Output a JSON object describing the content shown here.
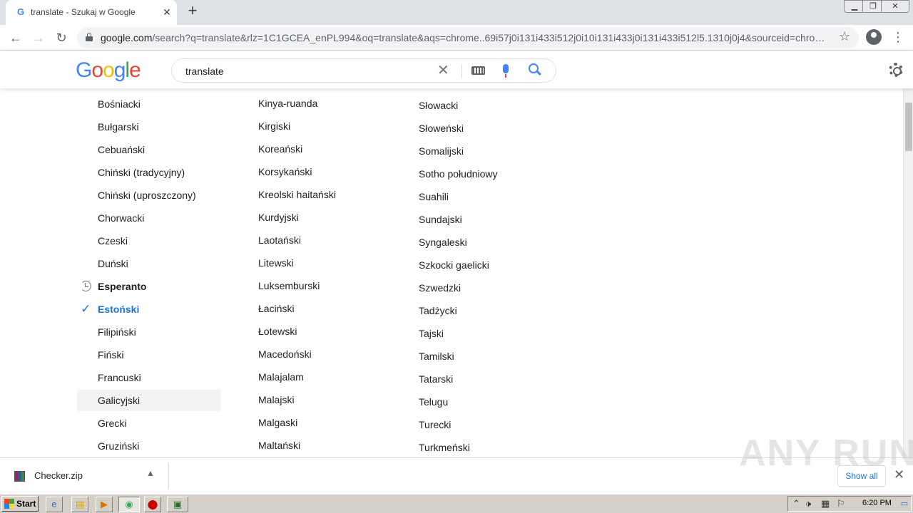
{
  "tab": {
    "favicon": "G",
    "title": "translate - Szukaj w Google"
  },
  "toolbar": {
    "url_host": "google.com",
    "url_path": "/search?q=translate&rlz=1C1GCEA_enPL994&oq=translate&aqs=chrome..69i57j0i131i433i512j0i10i131i433j0i131i433i512l5.1310j0j4&sourceid=chrom..."
  },
  "google": {
    "logo_letters": [
      "G",
      "o",
      "o",
      "g",
      "l",
      "e"
    ],
    "logo_colors": [
      "#4285f4",
      "#ea4335",
      "#fbbc05",
      "#4285f4",
      "#34a853",
      "#ea4335"
    ],
    "search_query": "translate"
  },
  "languages": {
    "col1": [
      "Bośniacki",
      "Bułgarski",
      "Cebuański",
      "Chiński (tradycyjny)",
      "Chiński (uproszczony)",
      "Chorwacki",
      "Czeski",
      "Duński",
      "Esperanto",
      "Estoński",
      "Filipiński",
      "Fiński",
      "Francuski",
      "Galicyjski",
      "Grecki",
      "Gruziński"
    ],
    "col2": [
      "Kinya-ruanda",
      "Kirgiski",
      "Koreański",
      "Korsykański",
      "Kreolski haitański",
      "Kurdyjski",
      "Laotański",
      "Litewski",
      "Luksemburski",
      "Łaciński",
      "Łotewski",
      "Macedoński",
      "Malajalam",
      "Malajski",
      "Malgaski",
      "Maltański"
    ],
    "col3": [
      "Słowacki",
      "Słoweński",
      "Somalijski",
      "Sotho południowy",
      "Suahili",
      "Sundajski",
      "Syngaleski",
      "Szkocki gaelicki",
      "Szwedzki",
      "Tadżycki",
      "Tajski",
      "Tamilski",
      "Tatarski",
      "Telugu",
      "Turecki",
      "Turkmeński"
    ],
    "recent": "Esperanto",
    "selected": "Estoński",
    "hovered": "Galicyjski"
  },
  "downloads": {
    "filename": "Checker.zip",
    "show_all": "Show all"
  },
  "watermark": "ANY RUN",
  "taskbar": {
    "start": "Start",
    "clock": "6:20 PM"
  },
  "colors": {
    "accent": "#1a73e8",
    "text": "#202124"
  }
}
